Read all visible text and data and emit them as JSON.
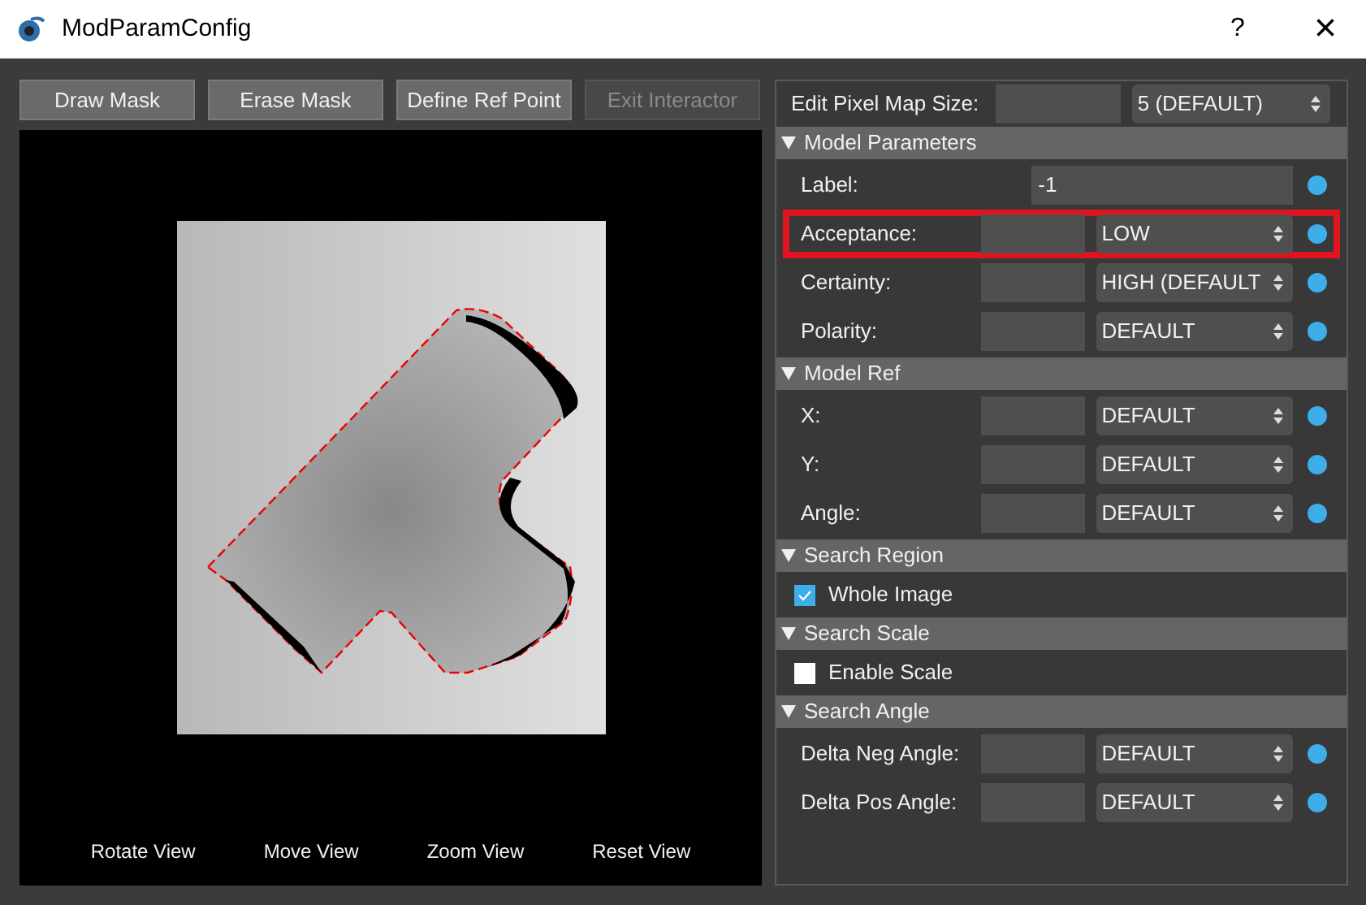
{
  "window": {
    "title": "ModParamConfig",
    "help": "?",
    "close": "×"
  },
  "toolbar": [
    {
      "label": "Draw Mask",
      "disabled": false
    },
    {
      "label": "Erase Mask",
      "disabled": false
    },
    {
      "label": "Define Ref Point",
      "disabled": false
    },
    {
      "label": "Exit Interactor",
      "disabled": true
    }
  ],
  "view_controls": [
    "Rotate View",
    "Move View",
    "Zoom View",
    "Reset View"
  ],
  "pixel_map": {
    "label": "Edit Pixel Map Size:",
    "value": "5 (DEFAULT)"
  },
  "sections": [
    {
      "title": "Model Parameters",
      "expanded": true,
      "rows": [
        {
          "kind": "text",
          "label": "Label:",
          "value": "-1",
          "highlighted": false
        },
        {
          "kind": "combo",
          "label": "Acceptance:",
          "value": "LOW",
          "highlighted": true
        },
        {
          "kind": "combo",
          "label": "Certainty:",
          "value": "HIGH (DEFAULT",
          "highlighted": false
        },
        {
          "kind": "combo",
          "label": "Polarity:",
          "value": "DEFAULT",
          "highlighted": false
        }
      ]
    },
    {
      "title": "Model Ref",
      "expanded": true,
      "rows": [
        {
          "kind": "combo",
          "label": "X:",
          "value": "DEFAULT",
          "highlighted": false
        },
        {
          "kind": "combo",
          "label": "Y:",
          "value": "DEFAULT",
          "highlighted": false
        },
        {
          "kind": "combo",
          "label": "Angle:",
          "value": "DEFAULT",
          "highlighted": false
        }
      ]
    },
    {
      "title": "Search Region",
      "expanded": true,
      "rows": [
        {
          "kind": "checkbox",
          "label": "Whole Image",
          "checked": true
        }
      ]
    },
    {
      "title": "Search Scale",
      "expanded": true,
      "rows": [
        {
          "kind": "checkbox",
          "label": "Enable Scale",
          "checked": false
        }
      ]
    },
    {
      "title": "Search Angle",
      "expanded": true,
      "rows": [
        {
          "kind": "combo",
          "label": "Delta Neg Angle:",
          "value": "DEFAULT",
          "highlighted": false
        },
        {
          "kind": "combo",
          "label": "Delta Pos Angle:",
          "value": "DEFAULT",
          "highlighted": false
        }
      ]
    }
  ]
}
